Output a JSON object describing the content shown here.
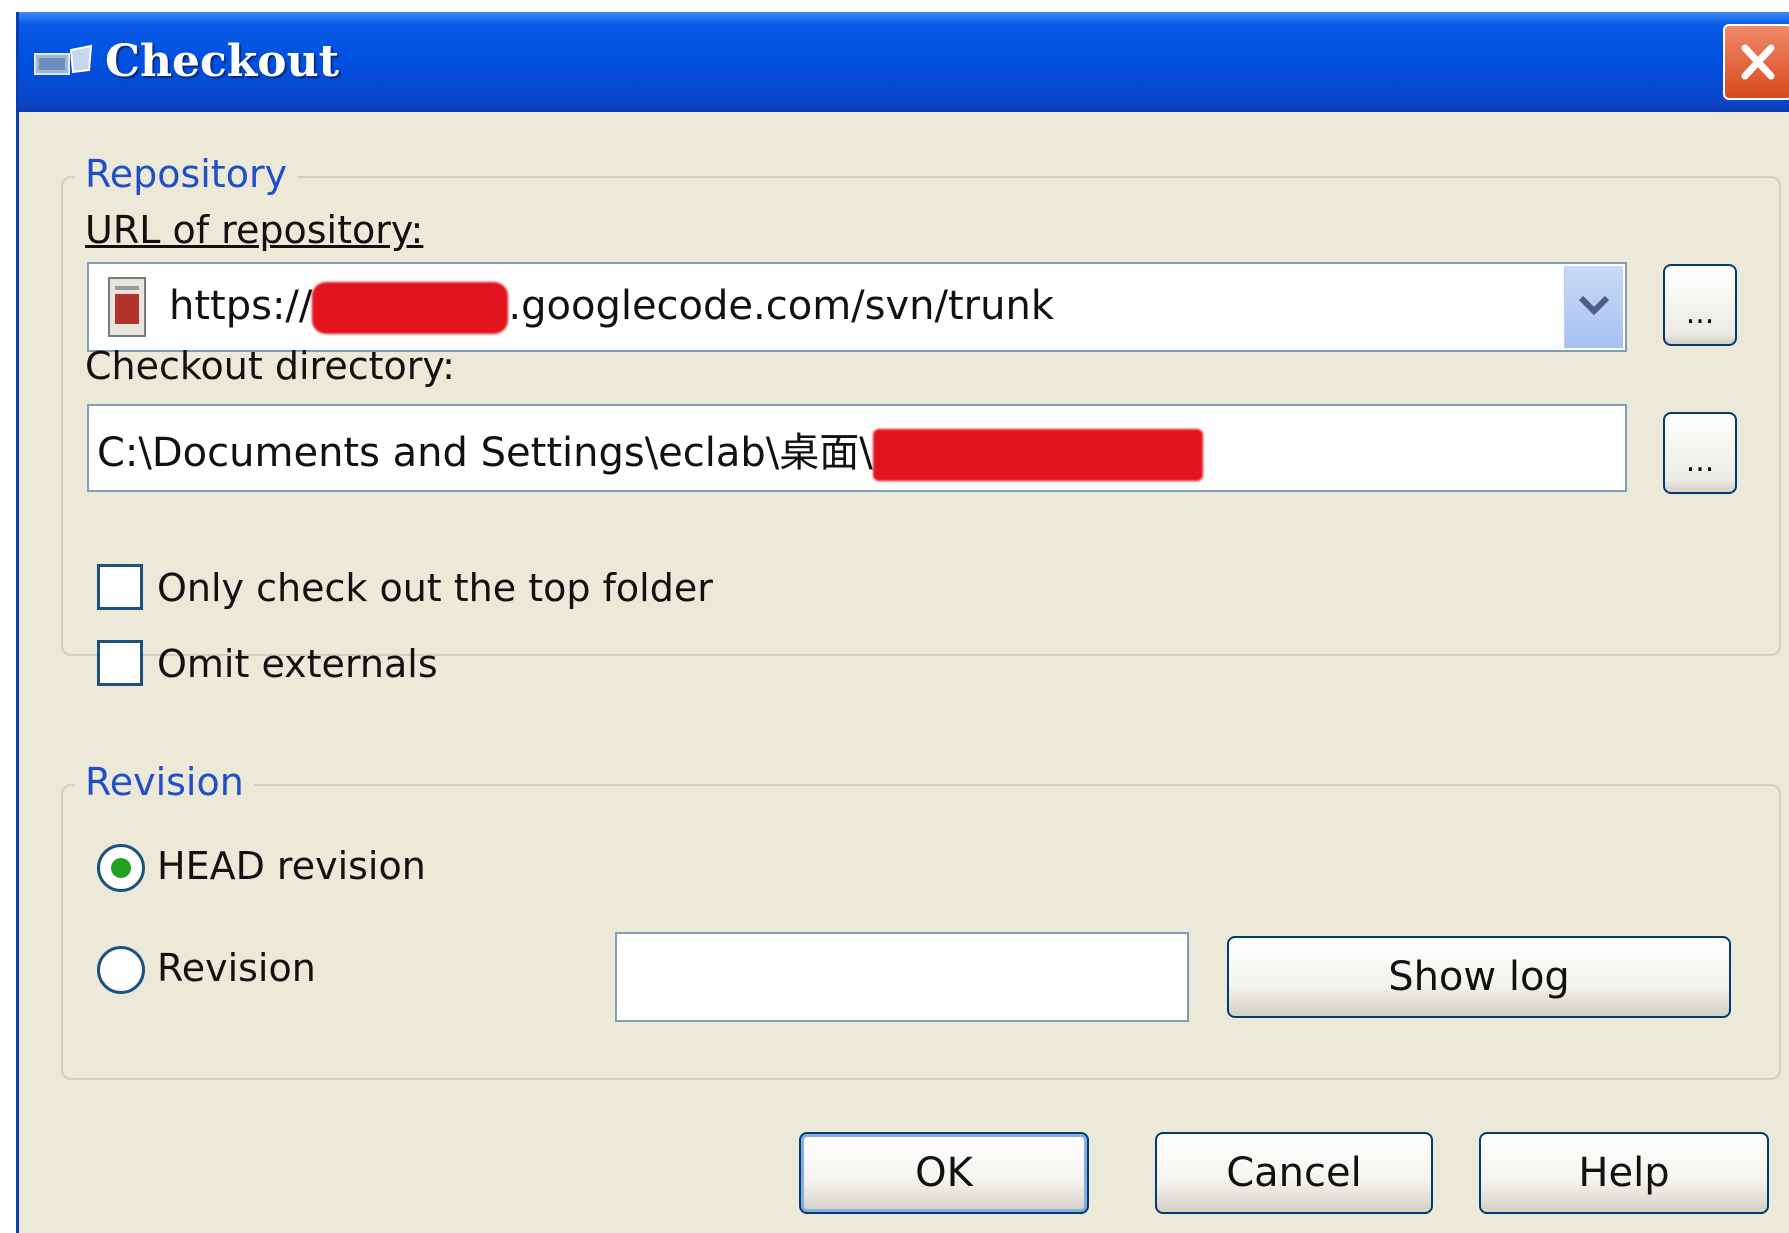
{
  "window": {
    "title": "Checkout"
  },
  "repository_group": {
    "legend": "Repository",
    "url_label": "URL of repository:",
    "url_prefix": "https://",
    "url_suffix": ".googlecode.com/svn/trunk",
    "browse_label": "...",
    "dir_label": "Checkout directory:",
    "dir_value": "C:\\Documents and Settings\\eclab\\桌面\\",
    "dir_browse_label": "...",
    "only_top_folder_label": "Only check out the top folder",
    "omit_externals_label": "Omit externals"
  },
  "revision_group": {
    "legend": "Revision",
    "head_label": "HEAD revision",
    "revision_label": "Revision",
    "revision_value": "",
    "show_log_label": "Show log"
  },
  "buttons": {
    "ok": "OK",
    "cancel": "Cancel",
    "help": "Help"
  },
  "state": {
    "head_selected": true,
    "only_top_folder_checked": false,
    "omit_externals_checked": false
  },
  "colors": {
    "titlebar": "#0050e0",
    "dialog_bg": "#ece9d8",
    "group_legend": "#2050c8",
    "redaction": "#e3141d"
  }
}
